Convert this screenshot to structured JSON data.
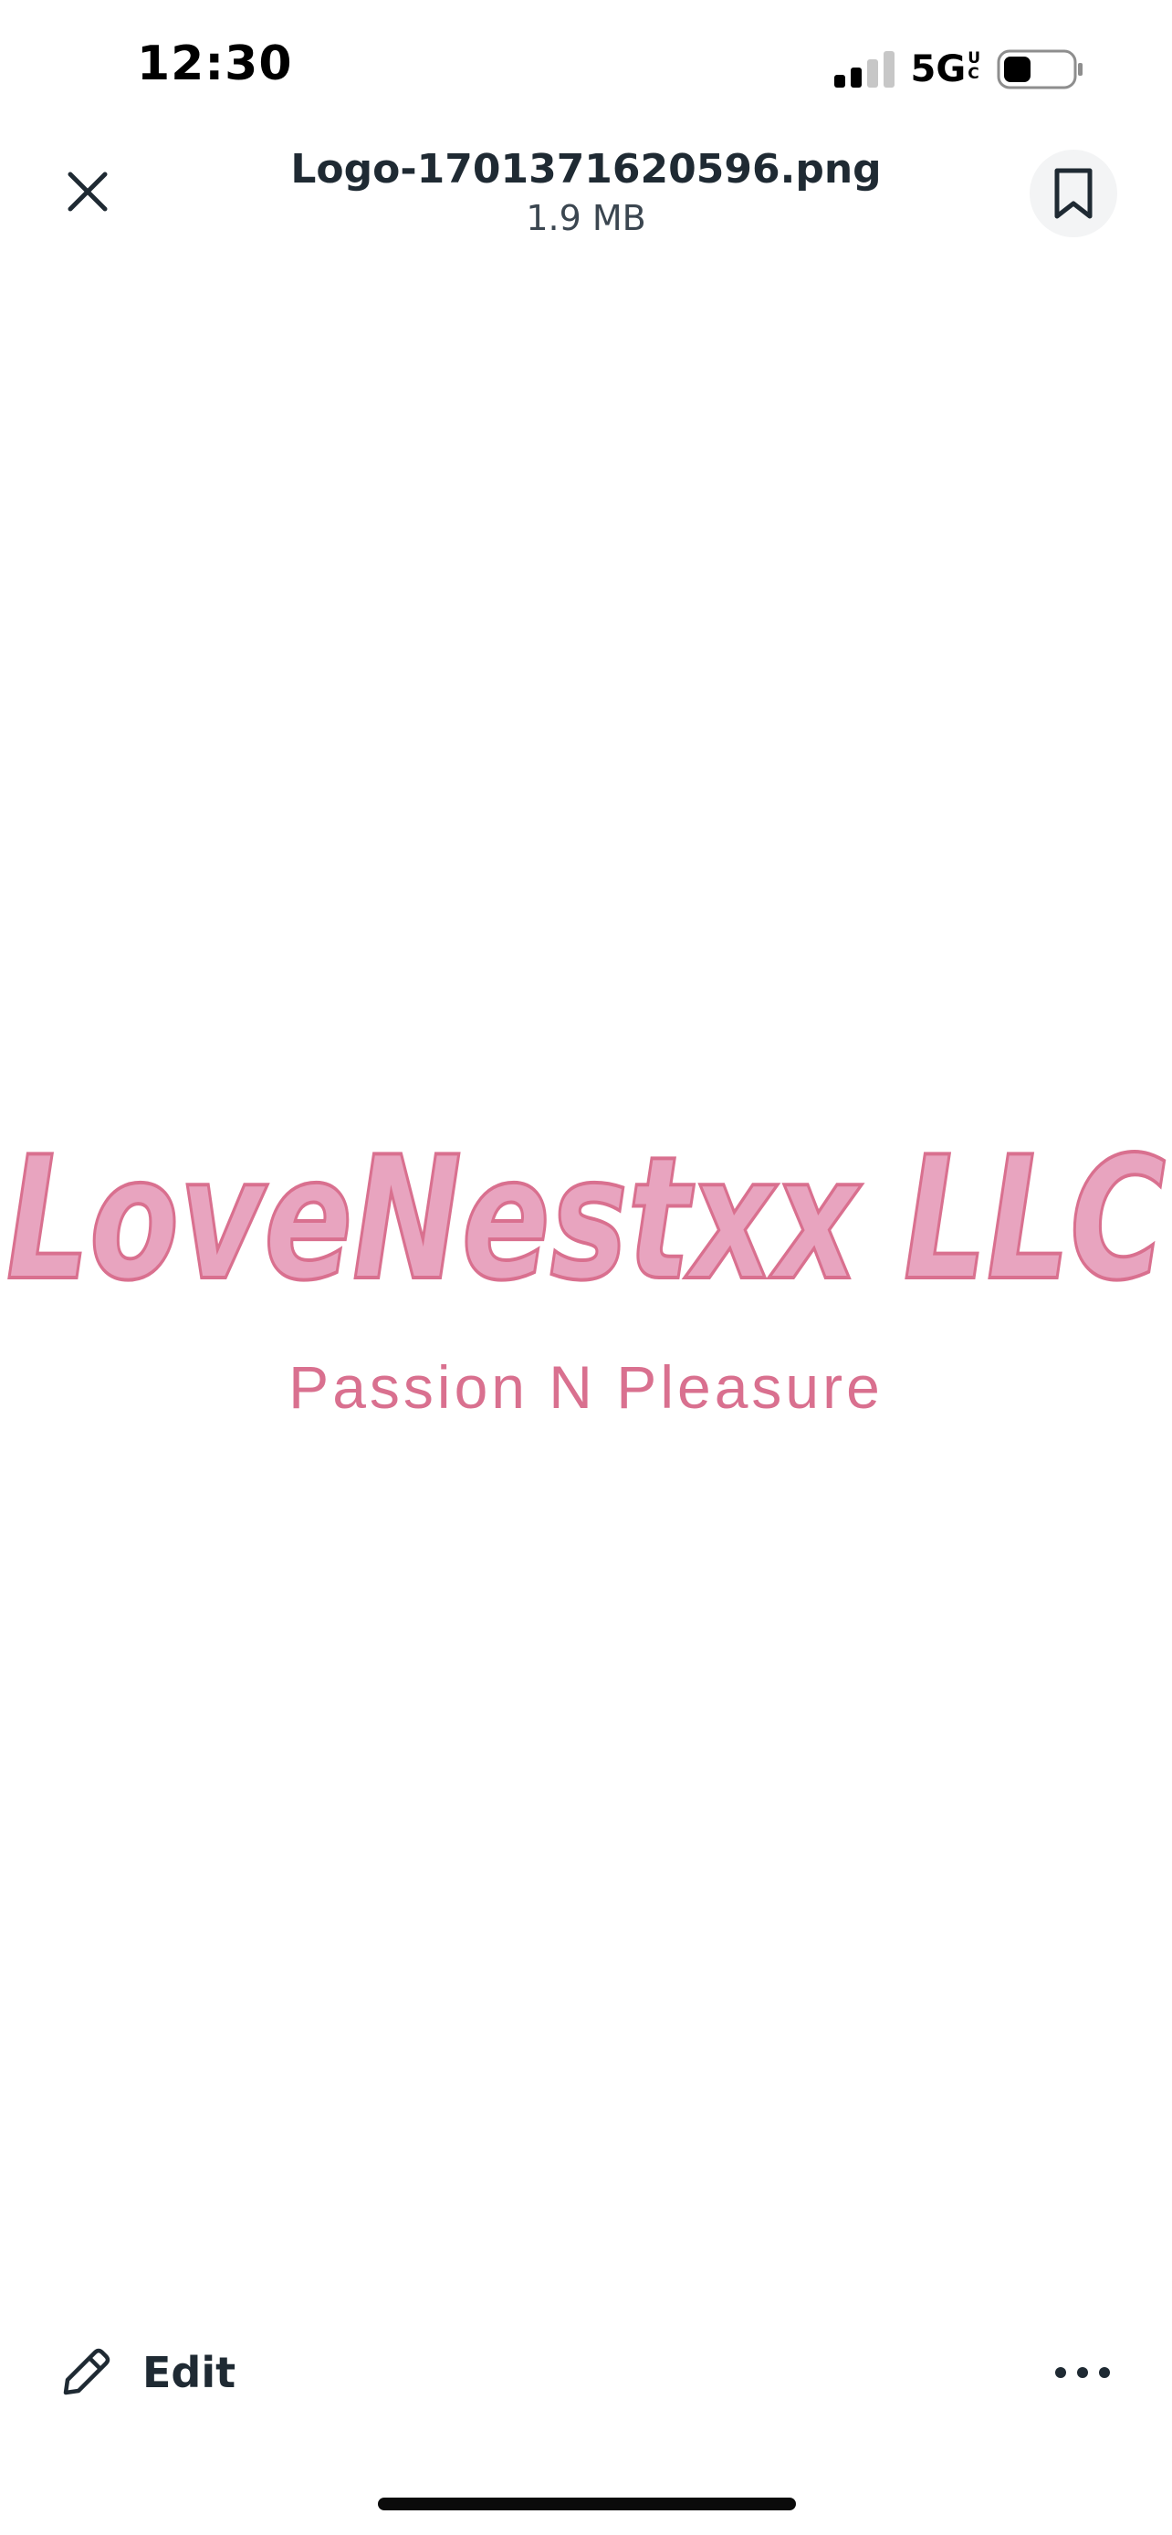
{
  "status_bar": {
    "time": "12:30",
    "network": "5G",
    "network_sub_top": "U",
    "network_sub_bottom": "C",
    "signal_icon": "cellular-signal-icon",
    "battery_icon": "battery-icon",
    "battery_level": 0.4
  },
  "header": {
    "close_icon": "close-icon",
    "file_name": "Logo-1701371620596.png",
    "file_size": "1.9 MB",
    "bookmark_icon": "bookmark-icon"
  },
  "preview": {
    "logo_title": "LoveNestxx LLC",
    "logo_tagline": "Passion N Pleasure",
    "logo_fill_color": "#e8a4bf",
    "logo_stroke_color": "#d9708f",
    "tagline_color": "#d9708f"
  },
  "toolbar": {
    "edit_icon": "pencil-icon",
    "edit_label": "Edit",
    "more_icon": "more-horizontal-icon"
  },
  "colors": {
    "text_primary": "#1f2a33",
    "bookmark_bg": "#f3f4f5",
    "background": "#ffffff"
  }
}
